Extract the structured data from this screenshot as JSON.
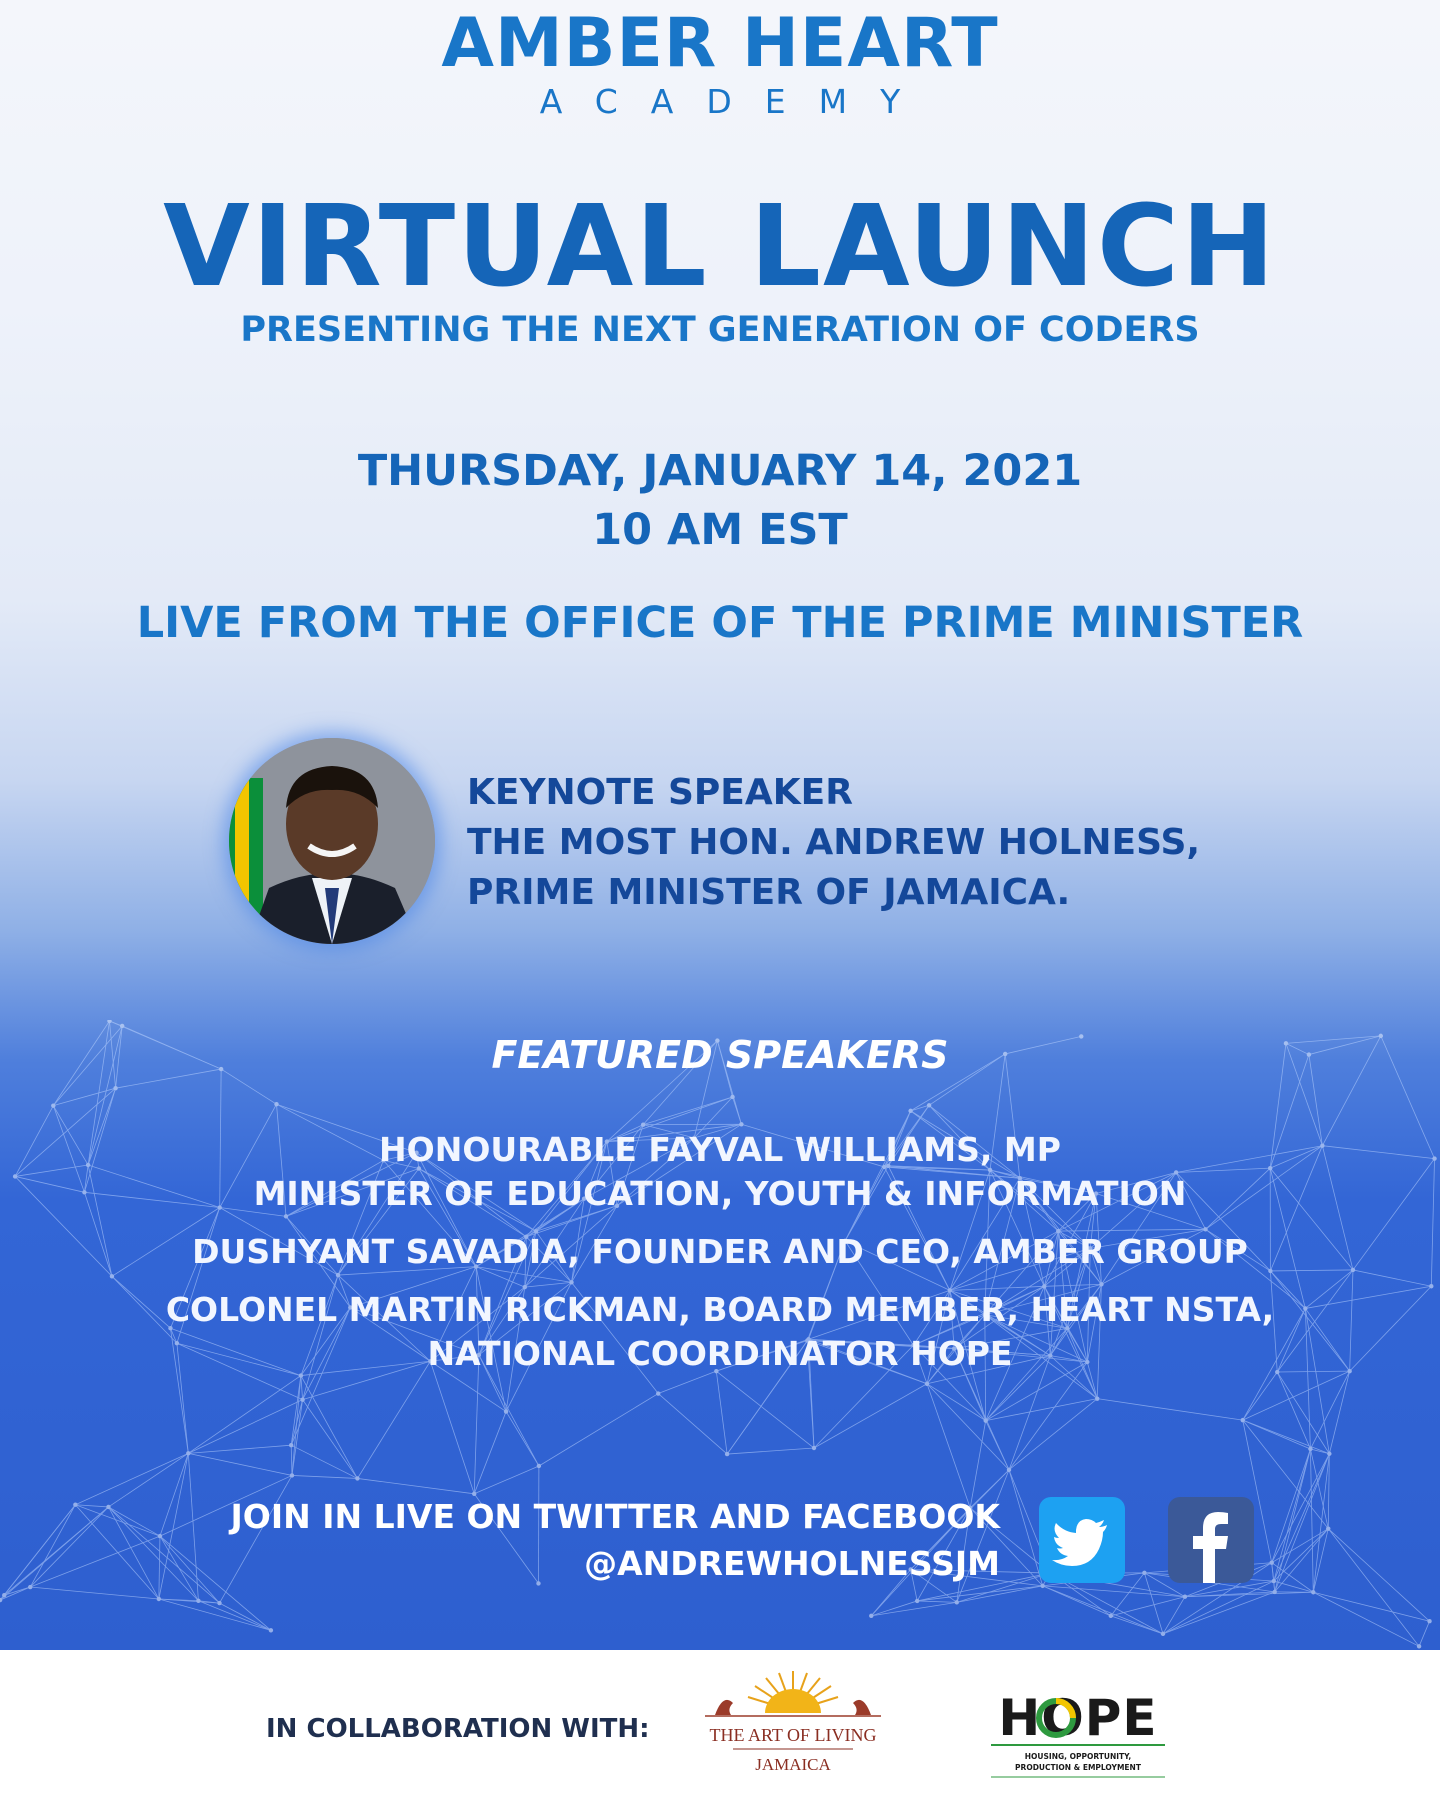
{
  "brand": {
    "name": "AMBER HEART",
    "sub": "ACADEMY"
  },
  "event": {
    "title": "VIRTUAL LAUNCH",
    "tagline": "PRESENTING THE NEXT GENERATION OF CODERS",
    "date": "THURSDAY, JANUARY 14, 2021",
    "time": "10 AM EST",
    "location": "LIVE FROM THE OFFICE OF THE PRIME MINISTER"
  },
  "keynote": {
    "heading": "KEYNOTE SPEAKER",
    "line1": "THE MOST HON. ANDREW HOLNESS,",
    "line2": "PRIME MINISTER OF JAMAICA."
  },
  "featured": {
    "heading": "FEATURED SPEAKERS",
    "lines": [
      "HONOURABLE FAYVAL WILLIAMS, MP",
      "MINISTER OF EDUCATION, YOUTH & INFORMATION",
      "DUSHYANT SAVADIA, FOUNDER AND CEO, AMBER GROUP",
      "COLONEL MARTIN RICKMAN, BOARD MEMBER, HEART NSTA,",
      "NATIONAL COORDINATOR HOPE"
    ]
  },
  "join": {
    "line1": "JOIN IN LIVE ON TWITTER AND FACEBOOK",
    "handle": "@ANDREWHOLNESSJM"
  },
  "social": {
    "icons": [
      "twitter-icon",
      "facebook-icon"
    ]
  },
  "footer": {
    "collab_label": "IN COLLABORATION WITH:",
    "aol": {
      "line1": "THE ART OF LIVING",
      "line2": "JAMAICA"
    },
    "hope": {
      "word": "HOPE",
      "line1": "HOUSING, OPPORTUNITY,",
      "line2": "PRODUCTION & EMPLOYMENT"
    }
  },
  "colors": {
    "brand_blue": "#1976c8",
    "title_blue": "#1565b8",
    "keynote_navy": "#14489a",
    "bg_blue": "#2e5fcf",
    "twitter": "#1da1f2",
    "facebook": "#3b5998"
  }
}
